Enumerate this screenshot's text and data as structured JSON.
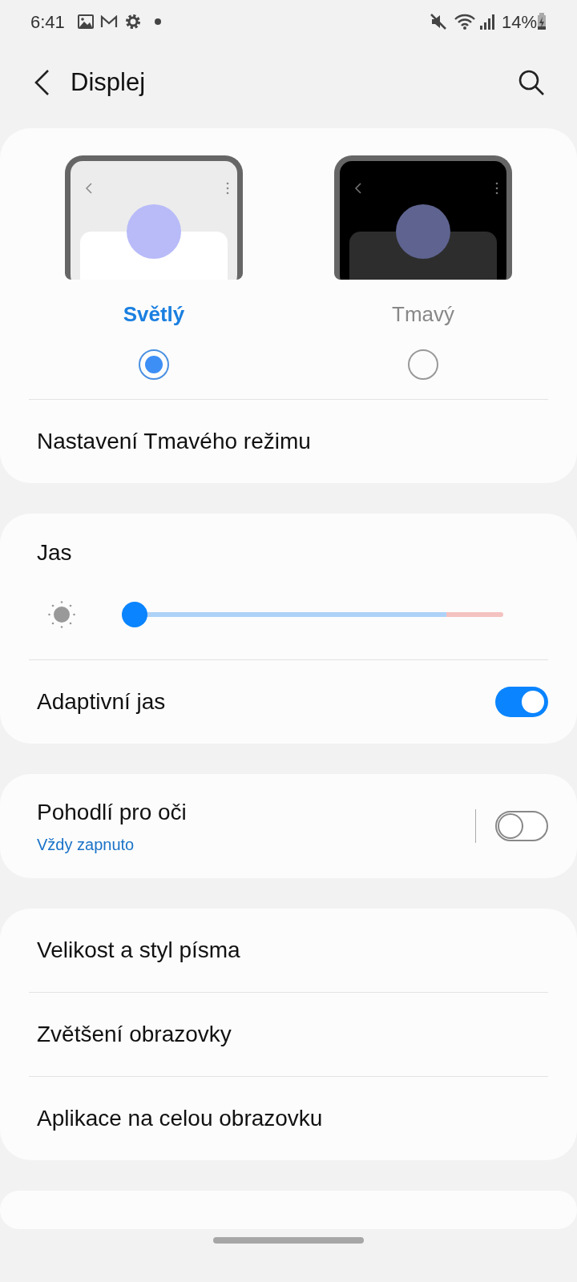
{
  "status_bar": {
    "time": "6:41",
    "battery": "14%"
  },
  "header": {
    "title": "Displej"
  },
  "themes": [
    {
      "label": "Světlý",
      "kind": "light",
      "selected": true
    },
    {
      "label": "Tmavý",
      "kind": "dark",
      "selected": false
    }
  ],
  "dark_mode_settings": {
    "label": "Nastavení Tmavého režimu"
  },
  "brightness": {
    "label": "Jas",
    "level": 0.0
  },
  "adaptive_brightness": {
    "label": "Adaptivní jas",
    "on": true
  },
  "eye_comfort": {
    "label": "Pohodlí pro oči",
    "subtitle": "Vždy zapnuto",
    "on": false
  },
  "menu_items": [
    {
      "label": "Velikost a styl písma"
    },
    {
      "label": "Zvětšení obrazovky"
    },
    {
      "label": "Aplikace na celou obrazovku"
    }
  ]
}
